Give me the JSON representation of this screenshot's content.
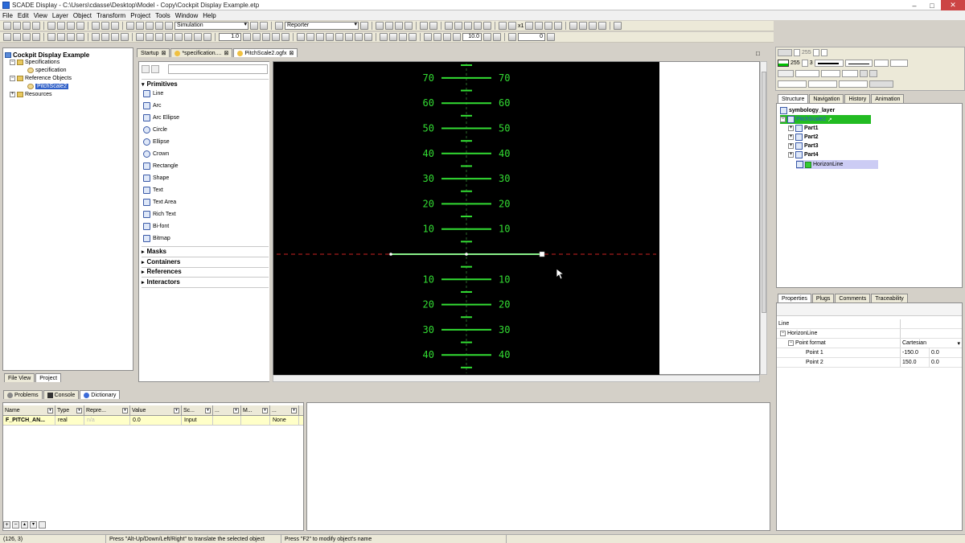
{
  "window": {
    "title": "SCADE Display - C:\\Users\\cdasse\\Desktop\\Model - Copy\\Cockpit Display Example.etp",
    "minimize": "–",
    "maximize": "□",
    "close": "✕"
  },
  "menu": [
    "File",
    "Edit",
    "View",
    "Layer",
    "Object",
    "Transform",
    "Project",
    "Tools",
    "Window",
    "Help"
  ],
  "toolbar": {
    "mode_combo": "Simulation",
    "reporter_combo": "Reporter",
    "line_width": "1.0",
    "zoom_label": "x1",
    "zoom_value": "10.0",
    "rotation_value": "0"
  },
  "project_tree": {
    "root": "Cockpit Display Example",
    "items": [
      {
        "label": "Specifications"
      },
      {
        "label": "specification"
      },
      {
        "label": "Reference Objects"
      },
      {
        "label": "PitchScale2"
      },
      {
        "label": "Resources"
      }
    ],
    "tabs": [
      "File View",
      "Project"
    ]
  },
  "editor_tabs": [
    {
      "label": "Startup"
    },
    {
      "label": "*specification...."
    },
    {
      "label": "PitchScale2.ogfx"
    }
  ],
  "palette": {
    "primitives_header": "Primitives",
    "primitives": [
      "Line",
      "Arc",
      "Arc Ellipse",
      "Circle",
      "Ellipse",
      "Crown",
      "Rectangle",
      "Shape",
      "Text",
      "Text Area",
      "Rich Text",
      "Bi-font",
      "Bitmap"
    ],
    "sections": [
      "Masks",
      "Containers",
      "References",
      "Interactors"
    ]
  },
  "pitch_scale": {
    "upper_labels": [
      "70",
      "60",
      "50",
      "40",
      "30",
      "20",
      "10"
    ],
    "lower_labels": [
      "10",
      "20",
      "30",
      "40"
    ],
    "line_color": "#33dd33",
    "horizon_color": "#cc2222",
    "background": "#000000"
  },
  "right_panel": {
    "stroke_value": "255",
    "stroke_value2": "255",
    "stroke_width": "3",
    "structure_tabs": [
      "Structure",
      "Navigation",
      "History",
      "Animation"
    ],
    "layer_name": "symbology_layer",
    "selected_object": "PitchScale2",
    "children": [
      "Part1",
      "Part2",
      "Part3",
      "Part4"
    ],
    "horizon": "HorizonLine",
    "prop_tabs": [
      "Properties",
      "Plugs",
      "Comments",
      "Traceability"
    ],
    "prop_type": "Line",
    "prop_object": "HorizonLine",
    "props": [
      {
        "key": "Point format",
        "value": "Cartesian",
        "value2": ""
      },
      {
        "key": "Point 1",
        "value": "-150.0",
        "value2": "0.0"
      },
      {
        "key": "Point 2",
        "value": "150.0",
        "value2": "0.0"
      }
    ]
  },
  "bottom_tabs": [
    "Problems",
    "Console",
    "Dictionary"
  ],
  "dictionary": {
    "headers": [
      "Name",
      "Type",
      "Repre...",
      "Value",
      "Sc...",
      "...",
      "M...",
      "..."
    ],
    "row": [
      "F_PITCH_AN...",
      "real",
      "n/a",
      "0.0",
      "Input",
      "",
      "",
      "None"
    ]
  },
  "status": {
    "coords": "(126, 3)",
    "hint1": "Press \"Alt-Up/Down/Left/Right\" to translate the selected object",
    "hint2": "Press \"F2\" to modify object's name"
  }
}
